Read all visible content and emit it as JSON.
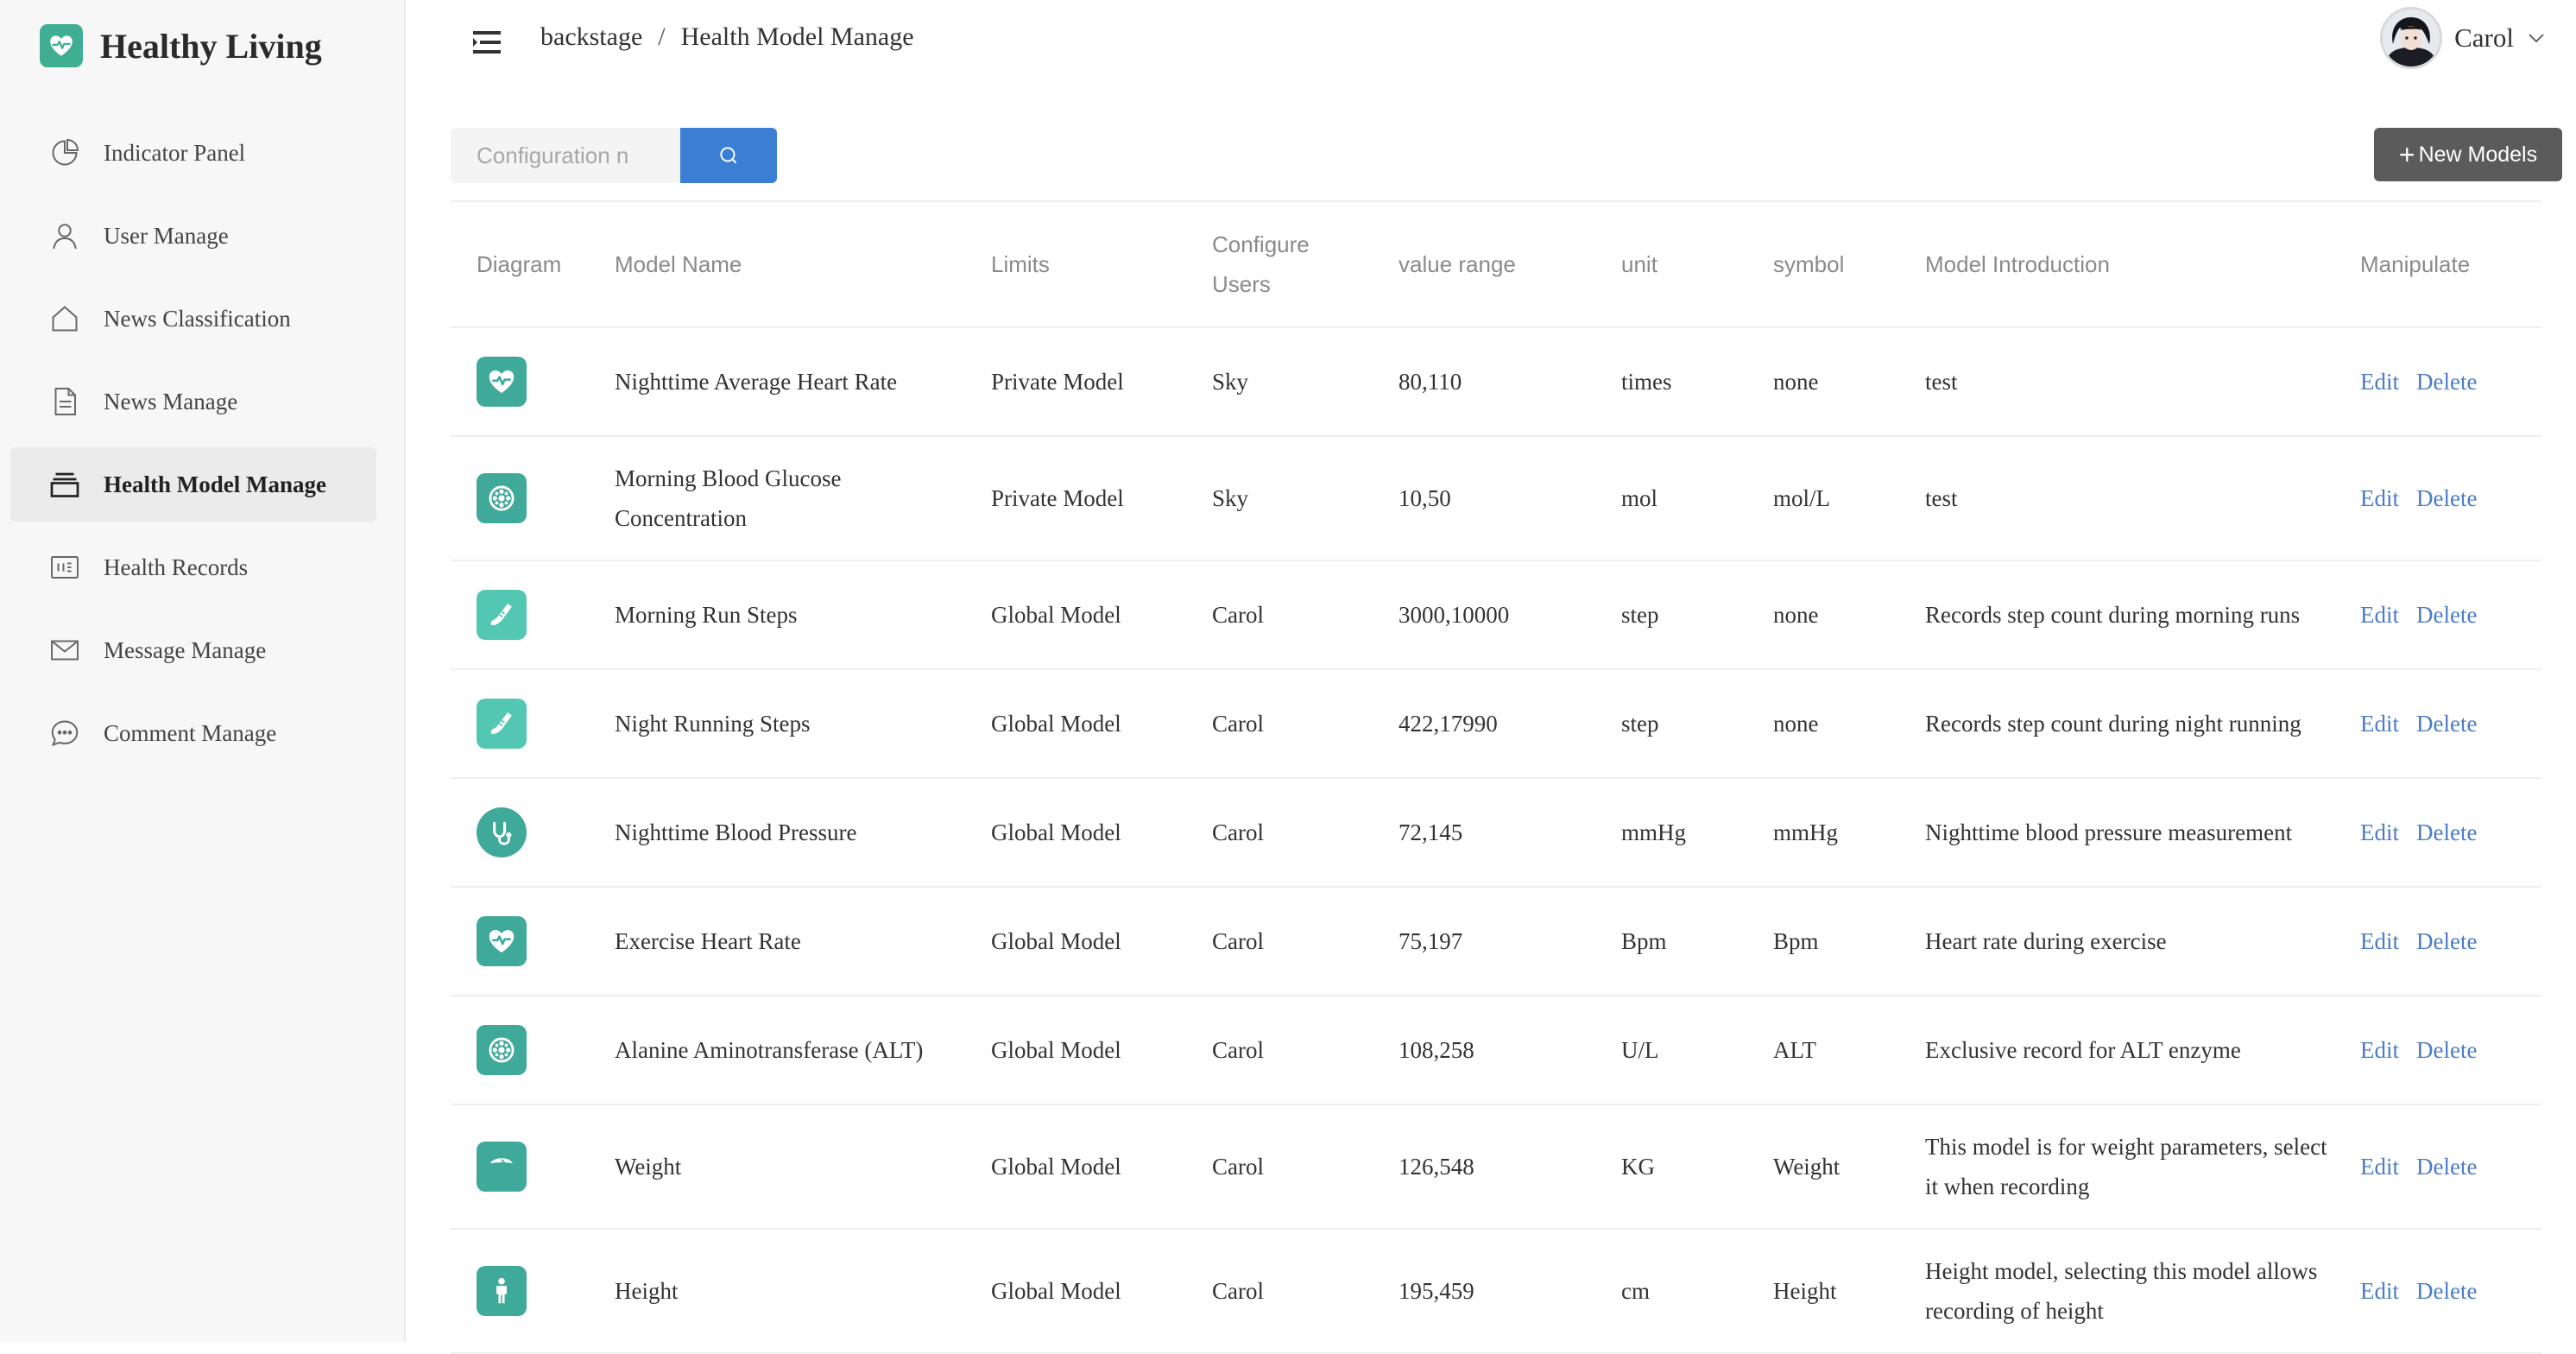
{
  "app": {
    "title": "Healthy Living",
    "logo_icon": "heart-pulse-icon",
    "accent_color": "#3fae91"
  },
  "sidebar": {
    "items": [
      {
        "label": "Indicator Panel",
        "icon": "pie-chart-icon",
        "active": false
      },
      {
        "label": "User Manage",
        "icon": "user-icon",
        "active": false
      },
      {
        "label": "News Classification",
        "icon": "home-icon",
        "active": false
      },
      {
        "label": "News Manage",
        "icon": "document-icon",
        "active": false
      },
      {
        "label": "Health Model Manage",
        "icon": "layers-icon",
        "active": true
      },
      {
        "label": "Health Records",
        "icon": "records-icon",
        "active": false
      },
      {
        "label": "Message Manage",
        "icon": "mail-icon",
        "active": false
      },
      {
        "label": "Comment Manage",
        "icon": "chat-icon",
        "active": false
      }
    ]
  },
  "header": {
    "breadcrumb": [
      "backstage",
      "Health Model Manage"
    ],
    "breadcrumb_separator": "/",
    "user_name": "Carol"
  },
  "toolbar": {
    "search_placeholder": "Configuration n",
    "search_value": "",
    "search_button_color": "#3b7fd4",
    "new_button_label": "New Models",
    "new_button_prefix": "+"
  },
  "table": {
    "headers": {
      "diagram": "Diagram",
      "name": "Model Name",
      "limits": "Limits",
      "users": "Configure Users",
      "range": "value range",
      "unit": "unit",
      "symbol": "symbol",
      "intro": "Model Introduction",
      "manip": "Manipulate"
    },
    "actions": {
      "edit": "Edit",
      "delete": "Delete"
    },
    "rows": [
      {
        "icon": "heart-rate-icon",
        "name": "Nighttime Average Heart Rate",
        "limits": "Private Model",
        "users": "Sky",
        "range": "80,110",
        "unit": "times",
        "symbol": "none",
        "intro": "test"
      },
      {
        "icon": "glucose-icon",
        "name": "Morning Blood Glucose Concentration",
        "limits": "Private Model",
        "users": "Sky",
        "range": "10,50",
        "unit": "mol",
        "symbol": "mol/L",
        "intro": "test"
      },
      {
        "icon": "running-shoe-icon",
        "name": "Morning Run Steps",
        "limits": "Global Model",
        "users": "Carol",
        "range": "3000,10000",
        "unit": "step",
        "symbol": "none",
        "intro": "Records step count during morning runs"
      },
      {
        "icon": "running-shoe-icon",
        "name": "Night Running Steps",
        "limits": "Global Model",
        "users": "Carol",
        "range": "422,17990",
        "unit": "step",
        "symbol": "none",
        "intro": "Records step count during night running"
      },
      {
        "icon": "blood-pressure-icon",
        "name": "Nighttime Blood Pressure",
        "limits": "Global Model",
        "users": "Carol",
        "range": "72,145",
        "unit": "mmHg",
        "symbol": "mmHg",
        "intro": "Nighttime blood pressure measurement"
      },
      {
        "icon": "heart-rate-icon",
        "name": "Exercise Heart Rate",
        "limits": "Global Model",
        "users": "Carol",
        "range": "75,197",
        "unit": "Bpm",
        "symbol": "Bpm",
        "intro": "Heart rate during exercise"
      },
      {
        "icon": "glucose-icon",
        "name": "Alanine Aminotransferase (ALT)",
        "limits": "Global Model",
        "users": "Carol",
        "range": "108,258",
        "unit": "U/L",
        "symbol": "ALT",
        "intro": "Exclusive record for ALT enzyme"
      },
      {
        "icon": "scale-icon",
        "name": "Weight",
        "limits": "Global Model",
        "users": "Carol",
        "range": "126,548",
        "unit": "KG",
        "symbol": "Weight",
        "intro": "This model is for weight parameters, select it when recording"
      },
      {
        "icon": "person-icon",
        "name": "Height",
        "limits": "Global Model",
        "users": "Carol",
        "range": "195,459",
        "unit": "cm",
        "symbol": "Height",
        "intro": "Height model, selecting this model allows recording of height"
      }
    ]
  }
}
